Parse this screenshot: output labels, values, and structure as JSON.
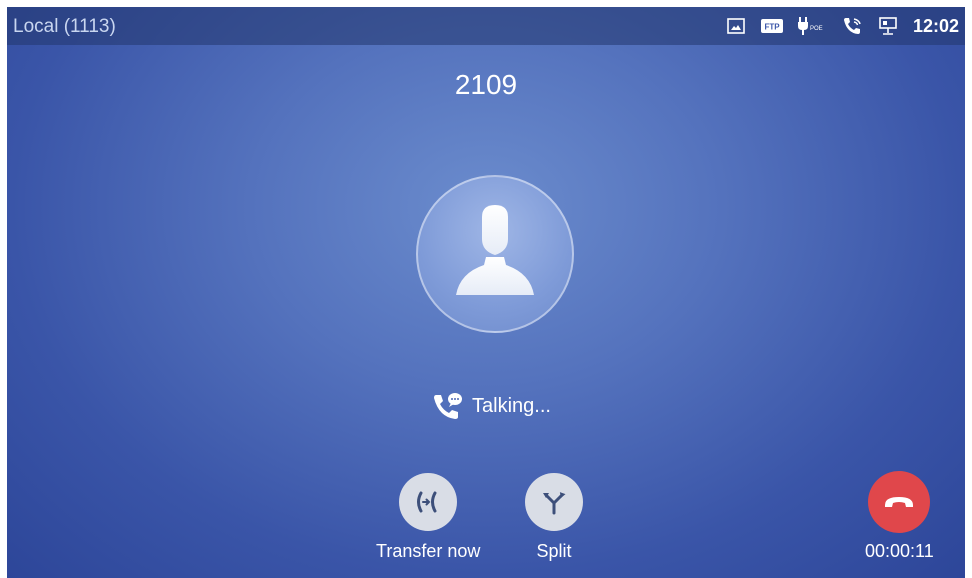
{
  "statusbar": {
    "account": "Local (1113)",
    "icons": [
      "screenshot-icon",
      "ftp-icon",
      "poe-icon",
      "call-active-icon",
      "network-icon"
    ],
    "ftp_label": "FTP",
    "poe_label": "POE",
    "time": "12:02"
  },
  "call": {
    "number": "2109",
    "state": "Talking...",
    "duration": "00:00:11"
  },
  "actions": {
    "transfer_label": "Transfer now",
    "split_label": "Split"
  },
  "colors": {
    "hangup": "#e0474b",
    "action_bg": "#d9dde6",
    "background": "#4a66b5"
  }
}
